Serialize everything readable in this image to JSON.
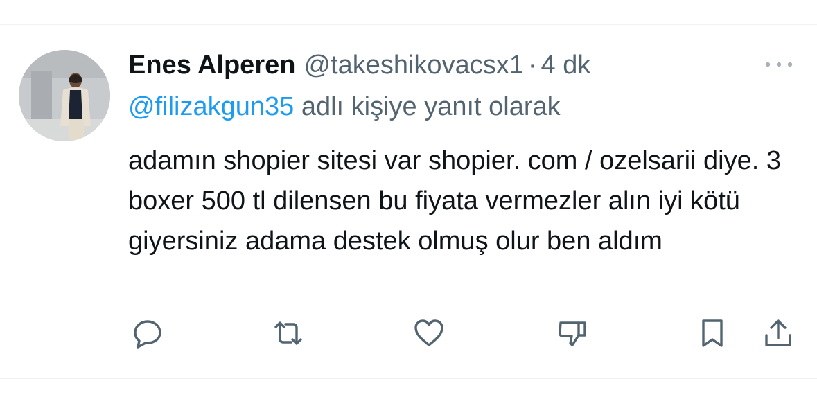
{
  "tweet": {
    "author": {
      "display_name": "Enes Alperen",
      "handle": "@takeshikovacsx1",
      "avatar_icon": "user-avatar-photo"
    },
    "separator": "·",
    "time": "4 dk",
    "reply_to": {
      "mention": "@filizakgun35",
      "suffix": " adlı kişiye yanıt olarak"
    },
    "text": "adamın shopier sitesi var shopier. com / ozelsarii diye. 3 boxer 500 tl dilensen bu fiyata vermezler alın iyi kötü giyersiniz adama destek olmuş olur ben aldım"
  },
  "actions": [
    {
      "name": "reply",
      "icon": "reply-icon"
    },
    {
      "name": "retweet",
      "icon": "retweet-icon"
    },
    {
      "name": "like",
      "icon": "heart-icon"
    },
    {
      "name": "dislike",
      "icon": "thumbs-down-icon"
    },
    {
      "name": "bookmark",
      "icon": "bookmark-icon"
    },
    {
      "name": "share",
      "icon": "share-icon"
    }
  ],
  "colors": {
    "text": "#0f1419",
    "secondary": "#536471",
    "link": "#1d9bf0",
    "divider": "#eff3f4"
  }
}
